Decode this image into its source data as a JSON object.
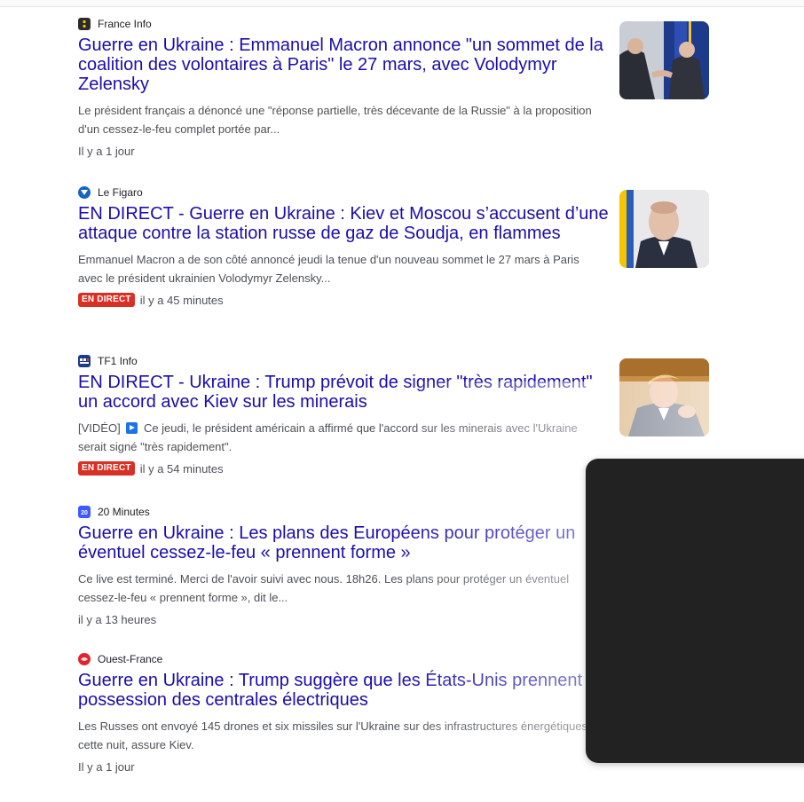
{
  "articles": [
    {
      "source": "France Info",
      "icon": "france-info-icon",
      "icon_color": "#2b2b2b",
      "title": "Guerre en Ukraine : Emmanuel Macron annonce \"un sommet de la coalition des volontaires à Paris\" le 27 mars, avec Volodymyr Zelensky",
      "snippet": "Le président français a dénoncé une \"réponse partielle, très décevante de la Russie\" à la proposition d'un cessez-le-feu complet portée par...",
      "time": "Il y a 1 jour"
    },
    {
      "source": "Le Figaro",
      "icon": "le-figaro-icon",
      "icon_color": "#1565c0",
      "title": "EN DIRECT - Guerre en Ukraine : Kiev et Moscou s’accusent d’une attaque contre la station russe de gaz de Soudja, en flammes",
      "snippet": "Emmanuel Macron a de son côté annoncé jeudi la tenue d'un nouveau sommet le 27 mars à Paris avec le président ukrainien Volodymyr Zelensky...",
      "badge": "EN DIRECT",
      "time": "il y a 45 minutes"
    },
    {
      "source": "TF1 Info",
      "icon": "tf1-info-icon",
      "icon_color": "#1d3a8a",
      "title": "EN DIRECT - Ukraine : Trump prévoit de signer \"très rapidement\" un accord avec Kiev sur les minerais",
      "snippet_prefix": "[VIDÉO]",
      "snippet": "Ce jeudi, le président américain a affirmé que l'accord sur les minerais avec l'Ukraine serait signé \"très rapidement\".",
      "badge": "EN DIRECT",
      "time": "il y a 54 minutes"
    },
    {
      "source": "20 Minutes",
      "icon": "20-minutes-icon",
      "icon_color": "#3d5afe",
      "icon_text": "20",
      "title": "Guerre en Ukraine : Les plans des Européens pour protéger un éventuel cessez-le-feu « prennent forme »",
      "snippet": "Ce live est terminé. Merci de l'avoir suivi avec nous. 18h26. Les plans pour protéger un éventuel cessez-le-feu « prennent forme », dit le...",
      "time": "il y a 13 heures"
    },
    {
      "source": "Ouest-France",
      "icon": "ouest-france-icon",
      "icon_color": "#e0242f",
      "title": "Guerre en Ukraine : Trump suggère que les États-Unis prennent possession des centrales électriques",
      "snippet": "Les Russes ont envoyé 145 drones et six missiles sur l'Ukraine sur des infrastructures énergétiques cette nuit, assure Kiev.",
      "time": "Il y a 1 jour"
    }
  ]
}
